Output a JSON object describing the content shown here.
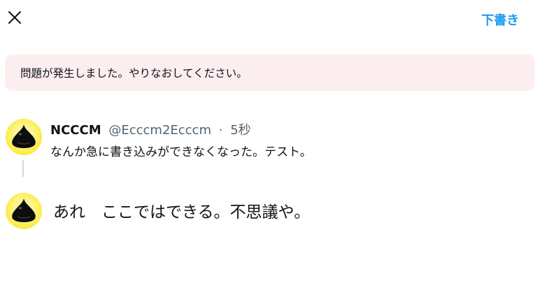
{
  "header": {
    "drafts_label": "下書き"
  },
  "error": {
    "message": "問題が発生しました。やりなおしてください。"
  },
  "tweet": {
    "display_name": "NCCCM",
    "handle": "@Ecccm2Ecccm",
    "separator": "·",
    "time": "5秒",
    "text": "なんか急に書き込みができなくなった。テスト。"
  },
  "composer": {
    "text": "あれ　ここではできる。不思議や。"
  },
  "colors": {
    "accent": "#1d9bf0",
    "error_bg": "#fdeef0",
    "text": "#0f1419",
    "secondary": "#536471",
    "avatar_bg": "#fff27a"
  },
  "icons": {
    "close": "close-icon",
    "avatar": "slime-avatar-icon"
  }
}
